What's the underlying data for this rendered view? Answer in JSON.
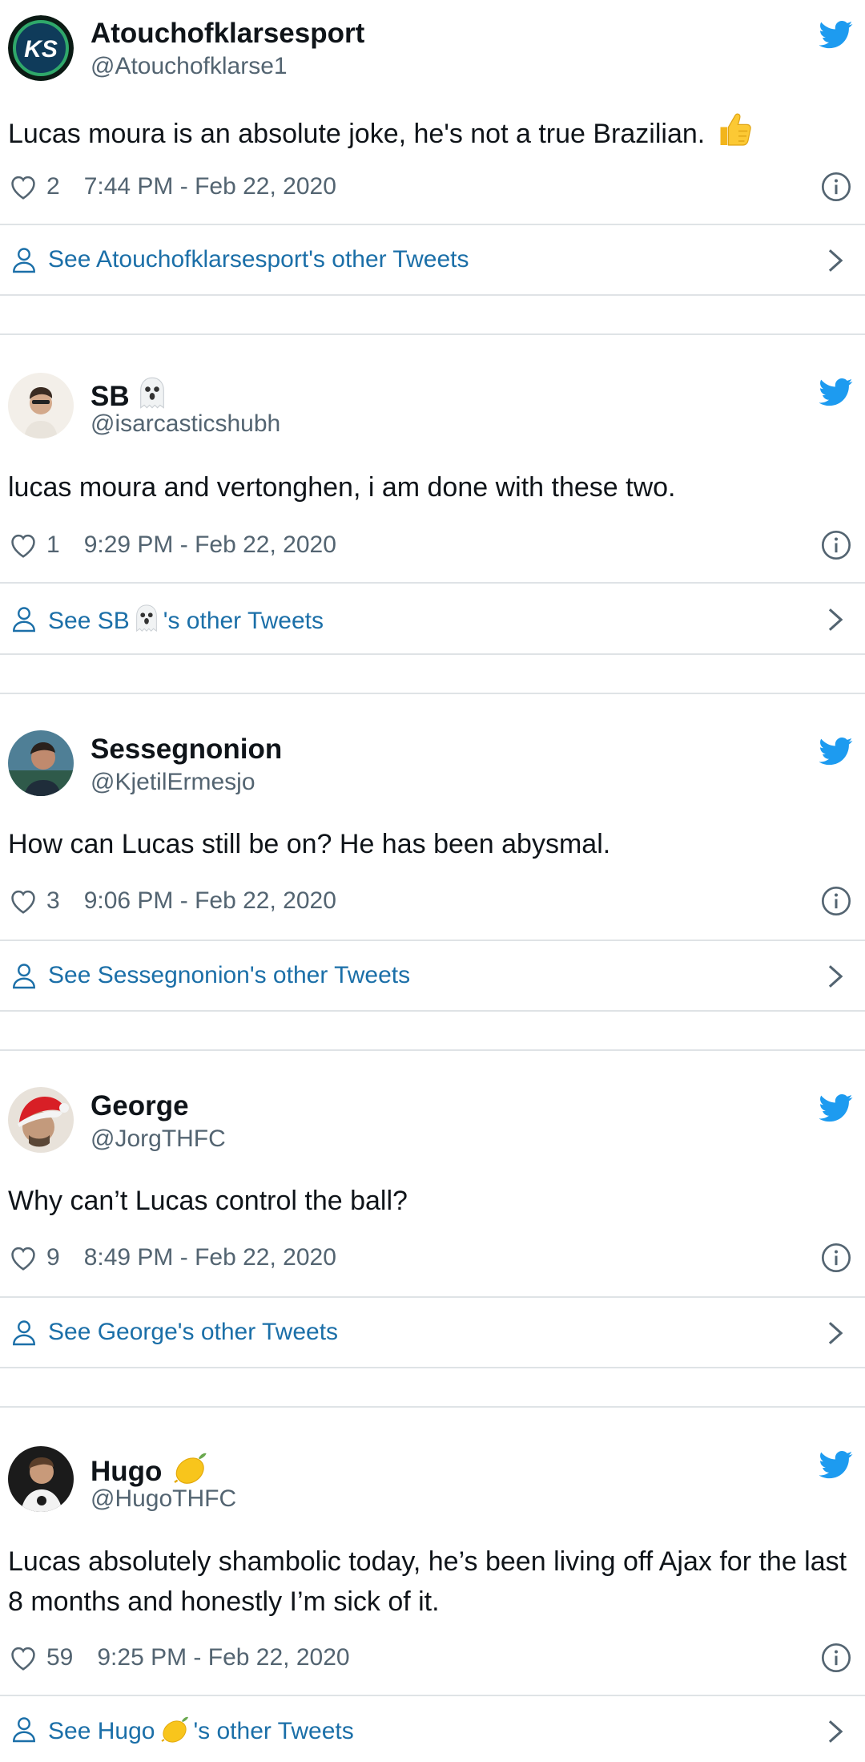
{
  "colors": {
    "link": "#1b6fa8",
    "twitter_blue": "#1d9bf0",
    "secondary_text": "#536471",
    "divider": "#dfe3e6"
  },
  "tweets": [
    {
      "name": "Atouchofklarsesport",
      "handle": "@Atouchofklarse1",
      "text": "Lucas moura is an absolute joke, he's not a true Brazilian.",
      "likes": "2",
      "time": "7:44 PM - Feb 22, 2020",
      "see_link": "See Atouchofklarsesport's other Tweets",
      "avatar_text": "KS",
      "name_emoji": "",
      "text_emoji": "thumbs-up"
    },
    {
      "name": "SB",
      "handle": "@isarcasticshubh",
      "text": "lucas moura and vertonghen, i am done with these two.",
      "likes": "1",
      "time": "9:29 PM - Feb 22, 2020",
      "see_link_prefix": "See SB",
      "see_link_suffix": "'s other Tweets",
      "name_emoji": "ghost"
    },
    {
      "name": "Sessegnonion",
      "handle": "@KjetilErmesjo",
      "text": "How can Lucas still be on? He has been abysmal.",
      "likes": "3",
      "time": "9:06 PM - Feb 22, 2020",
      "see_link": "See Sessegnonion's other Tweets",
      "name_emoji": ""
    },
    {
      "name": "George",
      "handle": "@JorgTHFC",
      "text": "Why can’t Lucas control the ball?",
      "likes": "9",
      "time": "8:49 PM - Feb 22, 2020",
      "see_link": "See George's other Tweets",
      "name_emoji": ""
    },
    {
      "name": "Hugo",
      "handle": "@HugoTHFC",
      "text": "Lucas absolutely shambolic today, he’s been living off Ajax for the last 8 months and honestly I’m sick of it.",
      "likes": "59",
      "time": "9:25 PM - Feb 22, 2020",
      "see_link_prefix": "See Hugo",
      "see_link_suffix": "'s other Tweets",
      "name_emoji": "lemon"
    }
  ]
}
